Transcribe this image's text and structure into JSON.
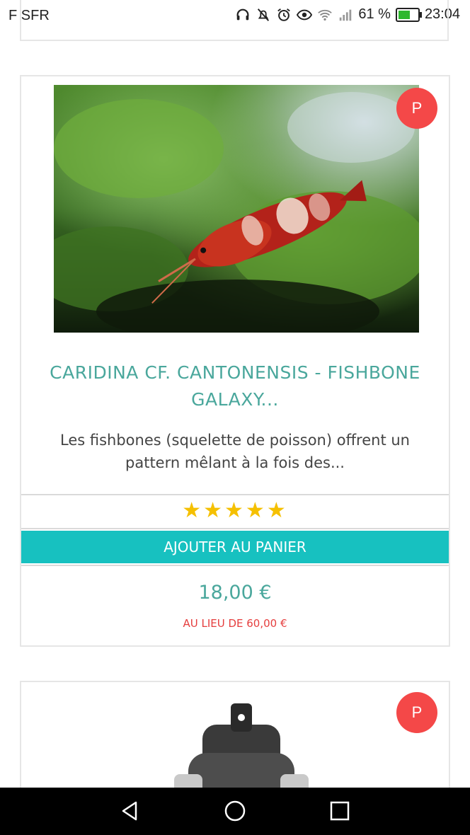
{
  "status_bar": {
    "carrier": "F SFR",
    "signal_text": "61 %",
    "battery_level": 0.61,
    "time": "23:04",
    "icons": [
      "headset-icon",
      "mute-icon",
      "alarm-icon",
      "eye-icon",
      "wifi-icon",
      "signal-icon",
      "battery-icon"
    ]
  },
  "product": {
    "badge": "P",
    "title": "CARIDINA CF. CANTONENSIS - FISHBONE GALAXY...",
    "description": "Les fishbones (squelette de poisson) offrent un pattern mêlant à la fois des...",
    "rating": 5,
    "stars": "★★★★★",
    "cart_button": "AJOUTER AU PANIER",
    "price": "18,00 €",
    "old_price": "AU LIEU DE 60,00 €",
    "image": "shrimp-photo"
  },
  "product2": {
    "badge": "P",
    "image": "filter-photo"
  },
  "nav": {
    "icons": [
      "back-icon",
      "home-icon",
      "recents-icon"
    ]
  },
  "colors": {
    "accent": "#4aa79c",
    "button": "#17c1c0",
    "badge": "#f44848",
    "old_price": "#e53e3e",
    "stars": "#f5c000"
  }
}
